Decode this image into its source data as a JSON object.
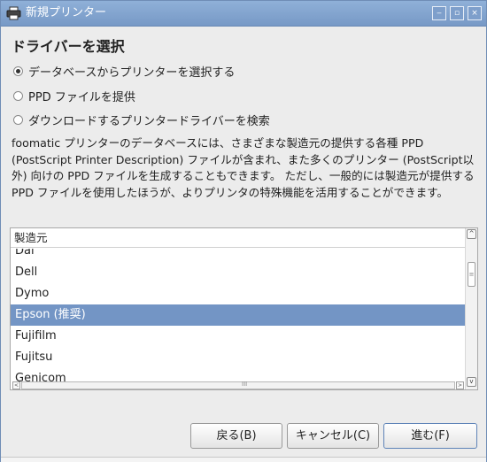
{
  "window": {
    "title": "新規プリンター",
    "controls": {
      "minimize": "‒",
      "maximize": "▫",
      "close": "×"
    }
  },
  "heading": "ドライバーを選択",
  "options": [
    {
      "label": "データベースからプリンターを選択する",
      "checked": true
    },
    {
      "label": "PPD ファイルを提供",
      "checked": false
    },
    {
      "label": "ダウンロードするプリンタードライバーを検索",
      "checked": false
    }
  ],
  "description": "foomatic プリンターのデータベースには、さまざまな製造元の提供する各種 PPD (PostScript Printer Description) ファイルが含まれ、また多くのプリンター (PostScript以外) 向けの PPD ファイルを生成することもできます。 ただし、一般的には製造元が提供する PPD ファイルを使用したほうが、よりプリンタの特殊機能を活用することができます。",
  "manufacturer_list": {
    "header": "製造元",
    "items": [
      "Dai",
      "Dell",
      "Dymo",
      "Epson (推奨)",
      "Fujifilm",
      "Fujitsu",
      "Genicom"
    ],
    "selected_index": 3
  },
  "scrollbar": {
    "up": "^",
    "down": "v",
    "thumb_grip": "≡",
    "left": "<",
    "right": ">",
    "h_grip": "III"
  },
  "buttons": {
    "back": "戻る(B)",
    "cancel": "キャンセル(C)",
    "next": "進む(F)"
  },
  "colors": {
    "selection": "#7395c5",
    "titlebar": "#7e9fcb"
  }
}
